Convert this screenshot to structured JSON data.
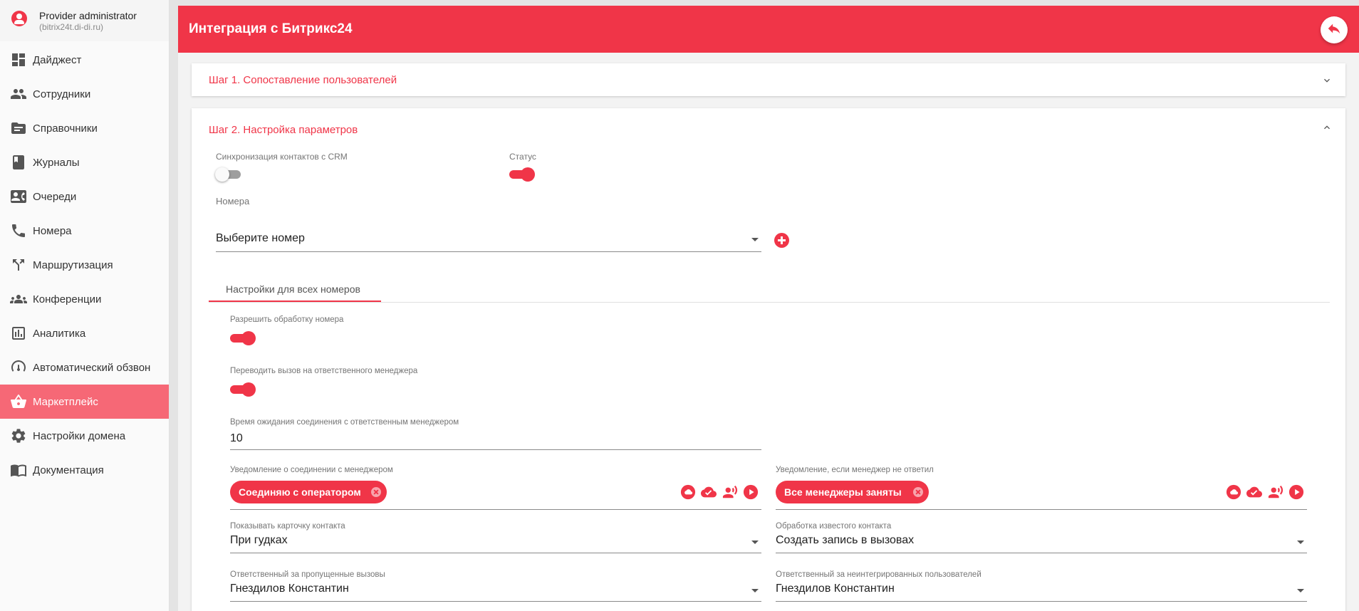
{
  "user": {
    "name": "Provider administrator",
    "domain": "(bitrix24t.di-di.ru)"
  },
  "nav": [
    {
      "label": "Дайджест",
      "icon": "dashboard-icon"
    },
    {
      "label": "Сотрудники",
      "icon": "people-icon"
    },
    {
      "label": "Справочники",
      "icon": "folder-icon"
    },
    {
      "label": "Журналы",
      "icon": "book-icon"
    },
    {
      "label": "Очереди",
      "icon": "contact-card-icon"
    },
    {
      "label": "Номера",
      "icon": "phone-icon"
    },
    {
      "label": "Маршрутизация",
      "icon": "call-split-icon"
    },
    {
      "label": "Конференции",
      "icon": "group-icon"
    },
    {
      "label": "Аналитика",
      "icon": "analytics-icon"
    },
    {
      "label": "Автоматический обзвон",
      "icon": "auto-dial-icon"
    },
    {
      "label": "Маркетплейс",
      "icon": "basket-icon",
      "active": true
    },
    {
      "label": "Настройки домена",
      "icon": "gear-icon"
    },
    {
      "label": "Документация",
      "icon": "docs-icon"
    }
  ],
  "header": {
    "title": "Интеграция с Битрикс24",
    "back_icon": "reply-icon"
  },
  "step1": {
    "title": "Шаг 1. Сопоставление пользователей",
    "expanded": false
  },
  "step2": {
    "title": "Шаг 2. Настройка параметров",
    "expanded": true,
    "crm_sync": {
      "label": "Синхронизация контактов с CRM",
      "on": false
    },
    "status": {
      "label": "Статус",
      "on": true
    },
    "numbers": {
      "label": "Номера",
      "placeholder": "Выберите номер"
    },
    "tab": "Настройки для всех номеров",
    "allow_processing": {
      "label": "Разрешить обработку номера",
      "on": true
    },
    "forward_manager": {
      "label": "Переводить вызов на ответственного менеджера",
      "on": true
    },
    "wait_time": {
      "label": "Время ожидания соединения с ответственным менеджером",
      "value": "10"
    },
    "notify_connect": {
      "label": "Уведомление о соединении с менеджером",
      "chip": "Соединяю с оператором"
    },
    "notify_noanswer": {
      "label": "Уведомление, если менеджер не ответил",
      "chip": "Все менеджеры заняты"
    },
    "show_card": {
      "label": "Показывать карточку контакта",
      "value": "При гудках"
    },
    "known_contact": {
      "label": "Обработка известого контакта",
      "value": "Создать запись в вызовах"
    },
    "missed_calls": {
      "label": "Ответственный за пропущенные вызовы",
      "value": "Гнездилов Константин"
    },
    "unintegrated": {
      "label": "Ответственный за неинтегрированных пользователей",
      "value": "Гнездилов Константин"
    }
  },
  "colors": {
    "accent": "#f03548",
    "active_nav": "#f66876"
  }
}
